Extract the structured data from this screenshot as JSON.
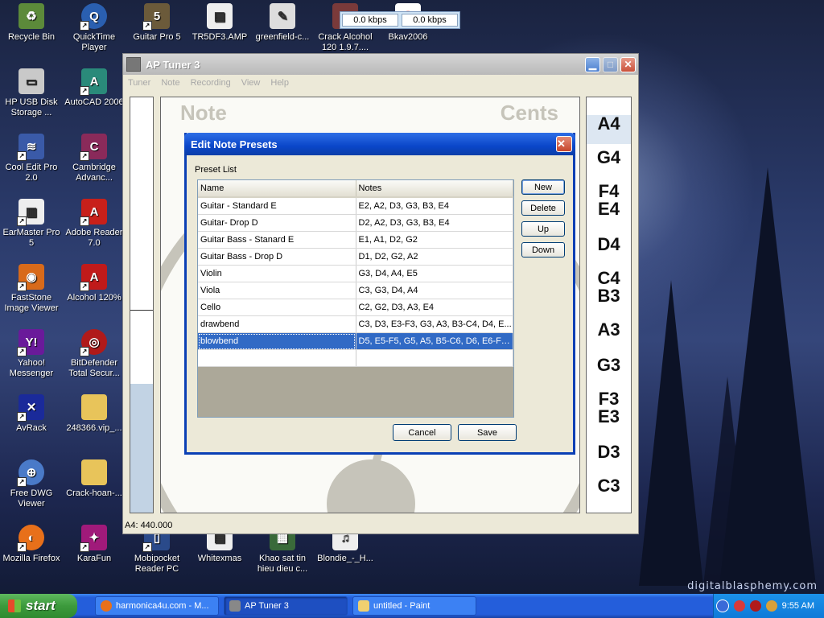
{
  "desktop": {
    "watermark": "digitalblasphemy.com",
    "icons": [
      {
        "label": "Recycle Bin",
        "icon": "recycle-bin-icon"
      },
      {
        "label": "QuickTime Player",
        "icon": "quicktime-icon"
      },
      {
        "label": "Guitar Pro 5",
        "icon": "guitar-pro-icon"
      },
      {
        "label": "TR5DF3.AMP",
        "icon": "amp-file-icon"
      },
      {
        "label": "greenfield-c...",
        "icon": "document-icon"
      },
      {
        "label": "Crack Alcohol 120 1.9.7....",
        "icon": "archive-icon"
      },
      {
        "label": "Bkav2006",
        "icon": "bkav-icon"
      },
      {
        "label": "HP USB Disk Storage ...",
        "icon": "usb-disk-icon"
      },
      {
        "label": "AutoCAD 2006",
        "icon": "autocad-icon"
      },
      {
        "label": "Cool Edit Pro 2.0",
        "icon": "cool-edit-icon"
      },
      {
        "label": "Cambridge Advanc...",
        "icon": "cambridge-icon"
      },
      {
        "label": "EarMaster Pro 5",
        "icon": "earmaster-icon"
      },
      {
        "label": "Adobe Reader 7.0",
        "icon": "adobe-reader-icon"
      },
      {
        "label": "FastStone Image Viewer",
        "icon": "faststone-icon"
      },
      {
        "label": "Alcohol 120%",
        "icon": "alcohol-icon"
      },
      {
        "label": "Yahoo! Messenger",
        "icon": "yahoo-icon"
      },
      {
        "label": "BitDefender Total Secur...",
        "icon": "bitdefender-icon"
      },
      {
        "label": "AvRack",
        "icon": "avrack-icon"
      },
      {
        "label": "248366.vip_...",
        "icon": "folder-icon"
      },
      {
        "label": "Free DWG Viewer",
        "icon": "dwg-viewer-icon"
      },
      {
        "label": "Crack-hoan-...",
        "icon": "folder-icon"
      },
      {
        "label": "Mozilla Firefox",
        "icon": "firefox-icon"
      },
      {
        "label": "KaraFun",
        "icon": "karafun-icon"
      },
      {
        "label": "Mobipocket Reader PC",
        "icon": "mobipocket-icon"
      },
      {
        "label": "Whitexmas",
        "icon": "document-icon"
      },
      {
        "label": "Khao sat tin hieu dieu c...",
        "icon": "archive-icon"
      },
      {
        "label": "Blondie_-_H...",
        "icon": "media-file-icon"
      }
    ]
  },
  "kbps": {
    "down": "0.0 kbps",
    "up": "0.0 kbps"
  },
  "aptuner": {
    "title": "AP Tuner 3",
    "menu": [
      "Tuner",
      "Note",
      "Recording",
      "View",
      "Help"
    ],
    "display_note_label": "Note",
    "display_cents_label": "Cents",
    "scale_notes": [
      "A4",
      "G4",
      "F4",
      "E4",
      "D4",
      "C4",
      "B3",
      "A3",
      "G3",
      "F3",
      "E3",
      "D3",
      "C3"
    ],
    "status": "A4: 440.000"
  },
  "dialog": {
    "title": "Edit Note Presets",
    "preset_list_label": "Preset List",
    "columns": [
      "Name",
      "Notes"
    ],
    "rows": [
      {
        "name": "Guitar - Standard E",
        "notes": "E2, A2, D3, G3, B3, E4"
      },
      {
        "name": "Guitar- Drop D",
        "notes": "D2, A2, D3, G3, B3, E4"
      },
      {
        "name": "Guitar Bass - Stanard E",
        "notes": "E1, A1, D2, G2"
      },
      {
        "name": "Guitar Bass - Drop D",
        "notes": "D1, D2, G2, A2"
      },
      {
        "name": "Violin",
        "notes": "G3, D4, A4, E5"
      },
      {
        "name": "Viola",
        "notes": "C3, G3, D4, A4"
      },
      {
        "name": "Cello",
        "notes": "C2, G2, D3, A3, E4"
      },
      {
        "name": "drawbend",
        "notes": "C3, D3, E3-F3, G3, A3, B3-C4, D4, E..."
      },
      {
        "name": "blowbend",
        "notes": "D5, E5-F5, G5, A5, B5-C6, D6, E6-F6..."
      }
    ],
    "selected_row": "blowbend",
    "buttons": {
      "new": "New",
      "delete": "Delete",
      "up": "Up",
      "down": "Down",
      "cancel": "Cancel",
      "save": "Save"
    }
  },
  "taskbar": {
    "start": "start",
    "tasks": [
      {
        "label": "harmonica4u.com - M...",
        "icon": "firefox-icon"
      },
      {
        "label": "AP Tuner 3",
        "icon": "aptuner-icon"
      },
      {
        "label": "untitled - Paint",
        "icon": "paint-icon"
      }
    ],
    "clock": "9:55 AM"
  }
}
